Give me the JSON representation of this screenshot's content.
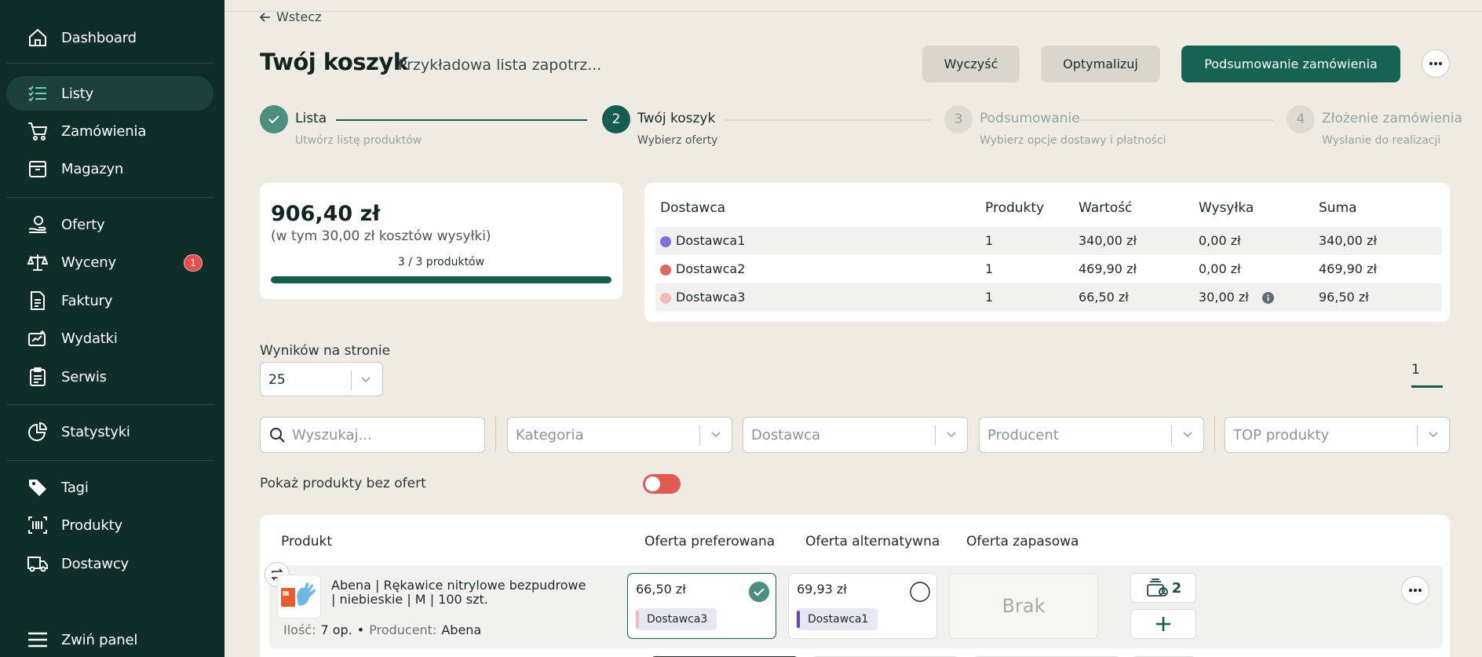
{
  "sidebar": {
    "items": [
      {
        "label": "Dashboard",
        "icon": "home-icon"
      },
      {
        "label": "Listy",
        "icon": "list-icon",
        "active": true
      },
      {
        "label": "Zamówienia",
        "icon": "cart-icon"
      },
      {
        "label": "Magazyn",
        "icon": "box-icon"
      },
      {
        "label": "Oferty",
        "icon": "offer-icon"
      },
      {
        "label": "Wyceny",
        "icon": "scale-icon",
        "badge": "1"
      },
      {
        "label": "Faktury",
        "icon": "invoice-icon"
      },
      {
        "label": "Wydatki",
        "icon": "expenses-icon"
      },
      {
        "label": "Serwis",
        "icon": "clipboard-icon"
      },
      {
        "label": "Statystyki",
        "icon": "chart-icon"
      },
      {
        "label": "Tagi",
        "icon": "tag-icon"
      },
      {
        "label": "Produkty",
        "icon": "barcode-icon"
      },
      {
        "label": "Dostawcy",
        "icon": "truck-icon"
      }
    ],
    "collapse_label": "Zwiń panel"
  },
  "header": {
    "back_label": "Wstecz",
    "title": "Twój koszyk",
    "subtitle": "Przykładowa lista zapotrz...",
    "clear_label": "Wyczyść",
    "optimize_label": "Optymalizuj",
    "summary_label": "Podsumowanie zamówienia"
  },
  "steps": [
    {
      "number": "1",
      "title": "Lista",
      "desc": "Utwórz listę produktów",
      "state": "done"
    },
    {
      "number": "2",
      "title": "Twój koszyk",
      "desc": "Wybierz oferty",
      "state": "current"
    },
    {
      "number": "3",
      "title": "Podsumowanie",
      "desc": "Wybierz opcje dostawy i płatności",
      "state": "pending"
    },
    {
      "number": "4",
      "title": "Złożenie zamówienia",
      "desc": "Wysłanie do realizacji",
      "state": "pending"
    }
  ],
  "summary": {
    "total": "906,40 zł",
    "shipping_note": "(w tym 30,00 zł kosztów wysyłki)",
    "products_count": "3 / 3 produktów",
    "progress": 1.0
  },
  "suppliers": {
    "headers": [
      "Dostawca",
      "Produkty",
      "Wartość",
      "Wysyłka",
      "Suma"
    ],
    "rows": [
      {
        "name": "Dostawca1",
        "color": "#7b6fe0",
        "products": "1",
        "value": "340,00 zł",
        "shipping": "0,00 zł",
        "sum": "340,00 zł"
      },
      {
        "name": "Dostawca2",
        "color": "#e16560",
        "products": "1",
        "value": "469,90 zł",
        "shipping": "0,00 zł",
        "sum": "469,90 zł"
      },
      {
        "name": "Dostawca3",
        "color": "#f4b9b9",
        "products": "1",
        "value": "66,50 zł",
        "shipping": "30,00 zł",
        "sum": "96,50 zł",
        "info_icon": "info-icon"
      }
    ]
  },
  "pagination": {
    "per_page_label": "Wyników na stronie",
    "per_page_value": "25",
    "current_page": "1"
  },
  "filters": {
    "search_placeholder": "Wyszukaj...",
    "category_placeholder": "Kategoria",
    "supplier_placeholder": "Dostawca",
    "producer_placeholder": "Producent",
    "top_placeholder": "TOP produkty"
  },
  "toggle": {
    "label": "Pokaż produkty bez ofert",
    "on": false
  },
  "products_table": {
    "headers": [
      "Produkt",
      "Oferta preferowana",
      "Oferta alternatywna",
      "Oferta zapasowa"
    ],
    "rows": [
      {
        "name": "Abena | Rękawice nitrylowe bezpudrowe | niebieskie | M | 100 szt.",
        "qty_label": "Ilość:",
        "qty": "7 op.",
        "separator": "•",
        "producer_label": "Producent:",
        "producer": "Abena",
        "preferred": {
          "price": "66,50 zł",
          "supplier": "Dostawca3",
          "color": "#f4b9b9",
          "selected": true
        },
        "alternative": {
          "price": "69,93 zł",
          "supplier": "Dostawca1",
          "color": "#6a3fd0",
          "selected": false
        },
        "backup": "Brak",
        "stock_count": "2"
      }
    ]
  }
}
